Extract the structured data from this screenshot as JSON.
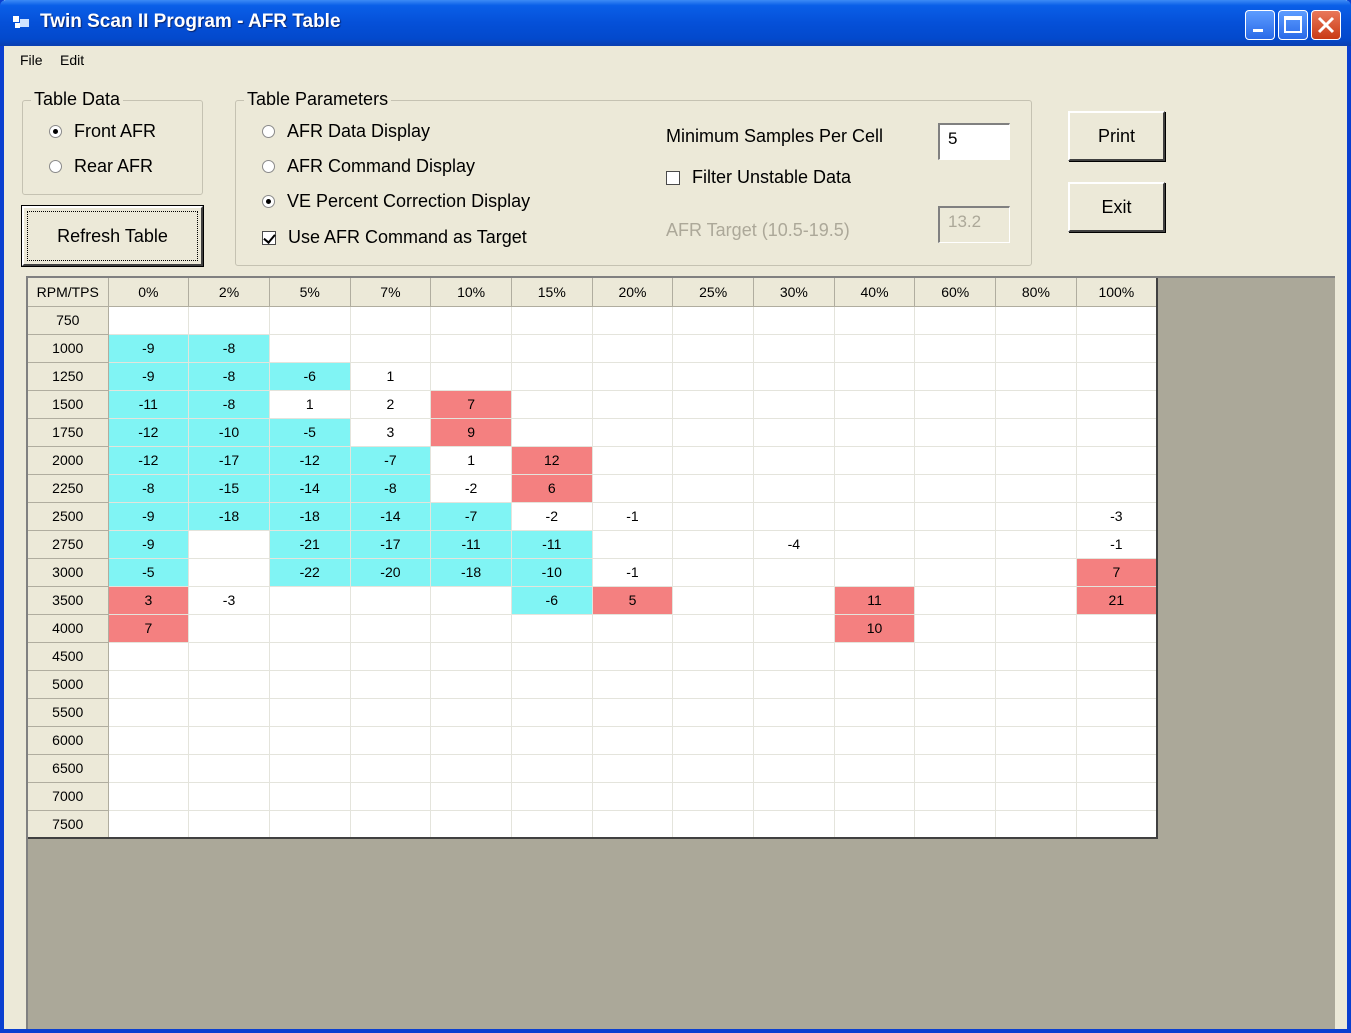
{
  "window": {
    "title": "Twin Scan II Program - AFR Table",
    "colors": {
      "titlebar": "#0550d8",
      "negative_cell": "#80f4f4",
      "positive_cell": "#f48080",
      "background": "#ece9d8"
    }
  },
  "menu": {
    "items": [
      "File",
      "Edit"
    ]
  },
  "table_data": {
    "title": "Table Data",
    "options": [
      {
        "label": "Front AFR",
        "selected": true
      },
      {
        "label": "Rear AFR",
        "selected": false
      }
    ]
  },
  "refresh_button": {
    "label": "Refresh Table"
  },
  "table_parameters": {
    "title": "Table Parameters",
    "options": [
      {
        "label": "AFR Data Display",
        "selected": false
      },
      {
        "label": "AFR Command Display",
        "selected": false
      },
      {
        "label": "VE Percent Correction Display",
        "selected": true
      }
    ],
    "use_command_target": {
      "label": "Use AFR Command as Target",
      "checked": true
    },
    "min_samples": {
      "label": "Minimum Samples Per Cell",
      "value": "5"
    },
    "filter_unstable": {
      "label": "Filter Unstable Data",
      "checked": false
    },
    "afr_target": {
      "label": "AFR Target (10.5-19.5)",
      "value": "13.2",
      "disabled": true
    }
  },
  "buttons": {
    "print": "Print",
    "exit": "Exit"
  },
  "grid": {
    "corner": "RPM/TPS",
    "columns": [
      "0%",
      "2%",
      "5%",
      "7%",
      "10%",
      "15%",
      "20%",
      "25%",
      "30%",
      "40%",
      "60%",
      "80%",
      "100%"
    ],
    "rows": [
      {
        "rpm": "750",
        "cells": [
          "",
          "",
          "",
          "",
          "",
          "",
          "",
          "",
          "",
          "",
          "",
          "",
          ""
        ]
      },
      {
        "rpm": "1000",
        "cells": [
          "-9",
          "-8",
          "",
          "",
          "",
          "",
          "",
          "",
          "",
          "",
          "",
          "",
          ""
        ]
      },
      {
        "rpm": "1250",
        "cells": [
          "-9",
          "-8",
          "-6",
          "1",
          "",
          "",
          "",
          "",
          "",
          "",
          "",
          "",
          ""
        ]
      },
      {
        "rpm": "1500",
        "cells": [
          "-11",
          "-8",
          "1",
          "2",
          "7",
          "",
          "",
          "",
          "",
          "",
          "",
          "",
          ""
        ]
      },
      {
        "rpm": "1750",
        "cells": [
          "-12",
          "-10",
          "-5",
          "3",
          "9",
          "",
          "",
          "",
          "",
          "",
          "",
          "",
          ""
        ]
      },
      {
        "rpm": "2000",
        "cells": [
          "-12",
          "-17",
          "-12",
          "-7",
          "1",
          "12",
          "",
          "",
          "",
          "",
          "",
          "",
          ""
        ]
      },
      {
        "rpm": "2250",
        "cells": [
          "-8",
          "-15",
          "-14",
          "-8",
          "-2",
          "6",
          "",
          "",
          "",
          "",
          "",
          "",
          ""
        ]
      },
      {
        "rpm": "2500",
        "cells": [
          "-9",
          "-18",
          "-18",
          "-14",
          "-7",
          "-2",
          "-1",
          "",
          "",
          "",
          "",
          "",
          "-3"
        ]
      },
      {
        "rpm": "2750",
        "cells": [
          "-9",
          "",
          "-21",
          "-17",
          "-11",
          "-11",
          "",
          "",
          "-4",
          "",
          "",
          "",
          "-1"
        ]
      },
      {
        "rpm": "3000",
        "cells": [
          "-5",
          "",
          "-22",
          "-20",
          "-18",
          "-10",
          "-1",
          "",
          "",
          "",
          "",
          "",
          "7"
        ]
      },
      {
        "rpm": "3500",
        "cells": [
          "3",
          "-3",
          "",
          "",
          "",
          "-6",
          "5",
          "",
          "",
          "11",
          "",
          "",
          "21"
        ]
      },
      {
        "rpm": "4000",
        "cells": [
          "7",
          "",
          "",
          "",
          "",
          "",
          "",
          "",
          "",
          "10",
          "",
          "",
          ""
        ]
      },
      {
        "rpm": "4500",
        "cells": [
          "",
          "",
          "",
          "",
          "",
          "",
          "",
          "",
          "",
          "",
          "",
          "",
          ""
        ]
      },
      {
        "rpm": "5000",
        "cells": [
          "",
          "",
          "",
          "",
          "",
          "",
          "",
          "",
          "",
          "",
          "",
          "",
          ""
        ]
      },
      {
        "rpm": "5500",
        "cells": [
          "",
          "",
          "",
          "",
          "",
          "",
          "",
          "",
          "",
          "",
          "",
          "",
          ""
        ]
      },
      {
        "rpm": "6000",
        "cells": [
          "",
          "",
          "",
          "",
          "",
          "",
          "",
          "",
          "",
          "",
          "",
          "",
          ""
        ]
      },
      {
        "rpm": "6500",
        "cells": [
          "",
          "",
          "",
          "",
          "",
          "",
          "",
          "",
          "",
          "",
          "",
          "",
          ""
        ]
      },
      {
        "rpm": "7000",
        "cells": [
          "",
          "",
          "",
          "",
          "",
          "",
          "",
          "",
          "",
          "",
          "",
          "",
          ""
        ]
      },
      {
        "rpm": "7500",
        "cells": [
          "",
          "",
          "",
          "",
          "",
          "",
          "",
          "",
          "",
          "",
          "",
          "",
          ""
        ]
      }
    ],
    "highlight": {
      "neg": [
        [
          1,
          0
        ],
        [
          1,
          1
        ],
        [
          2,
          0
        ],
        [
          2,
          1
        ],
        [
          2,
          2
        ],
        [
          3,
          0
        ],
        [
          3,
          1
        ],
        [
          4,
          0
        ],
        [
          4,
          1
        ],
        [
          4,
          2
        ],
        [
          5,
          0
        ],
        [
          5,
          1
        ],
        [
          5,
          2
        ],
        [
          5,
          3
        ],
        [
          6,
          0
        ],
        [
          6,
          1
        ],
        [
          6,
          2
        ],
        [
          6,
          3
        ],
        [
          7,
          0
        ],
        [
          7,
          1
        ],
        [
          7,
          2
        ],
        [
          7,
          3
        ],
        [
          7,
          4
        ],
        [
          8,
          0
        ],
        [
          8,
          2
        ],
        [
          8,
          3
        ],
        [
          8,
          4
        ],
        [
          8,
          5
        ],
        [
          9,
          0
        ],
        [
          9,
          2
        ],
        [
          9,
          3
        ],
        [
          9,
          4
        ],
        [
          9,
          5
        ],
        [
          10,
          5
        ]
      ],
      "pos": [
        [
          3,
          4
        ],
        [
          4,
          4
        ],
        [
          5,
          5
        ],
        [
          6,
          5
        ],
        [
          9,
          12
        ],
        [
          10,
          0
        ],
        [
          10,
          6
        ],
        [
          10,
          9
        ],
        [
          10,
          12
        ],
        [
          11,
          0
        ],
        [
          11,
          9
        ]
      ]
    }
  }
}
